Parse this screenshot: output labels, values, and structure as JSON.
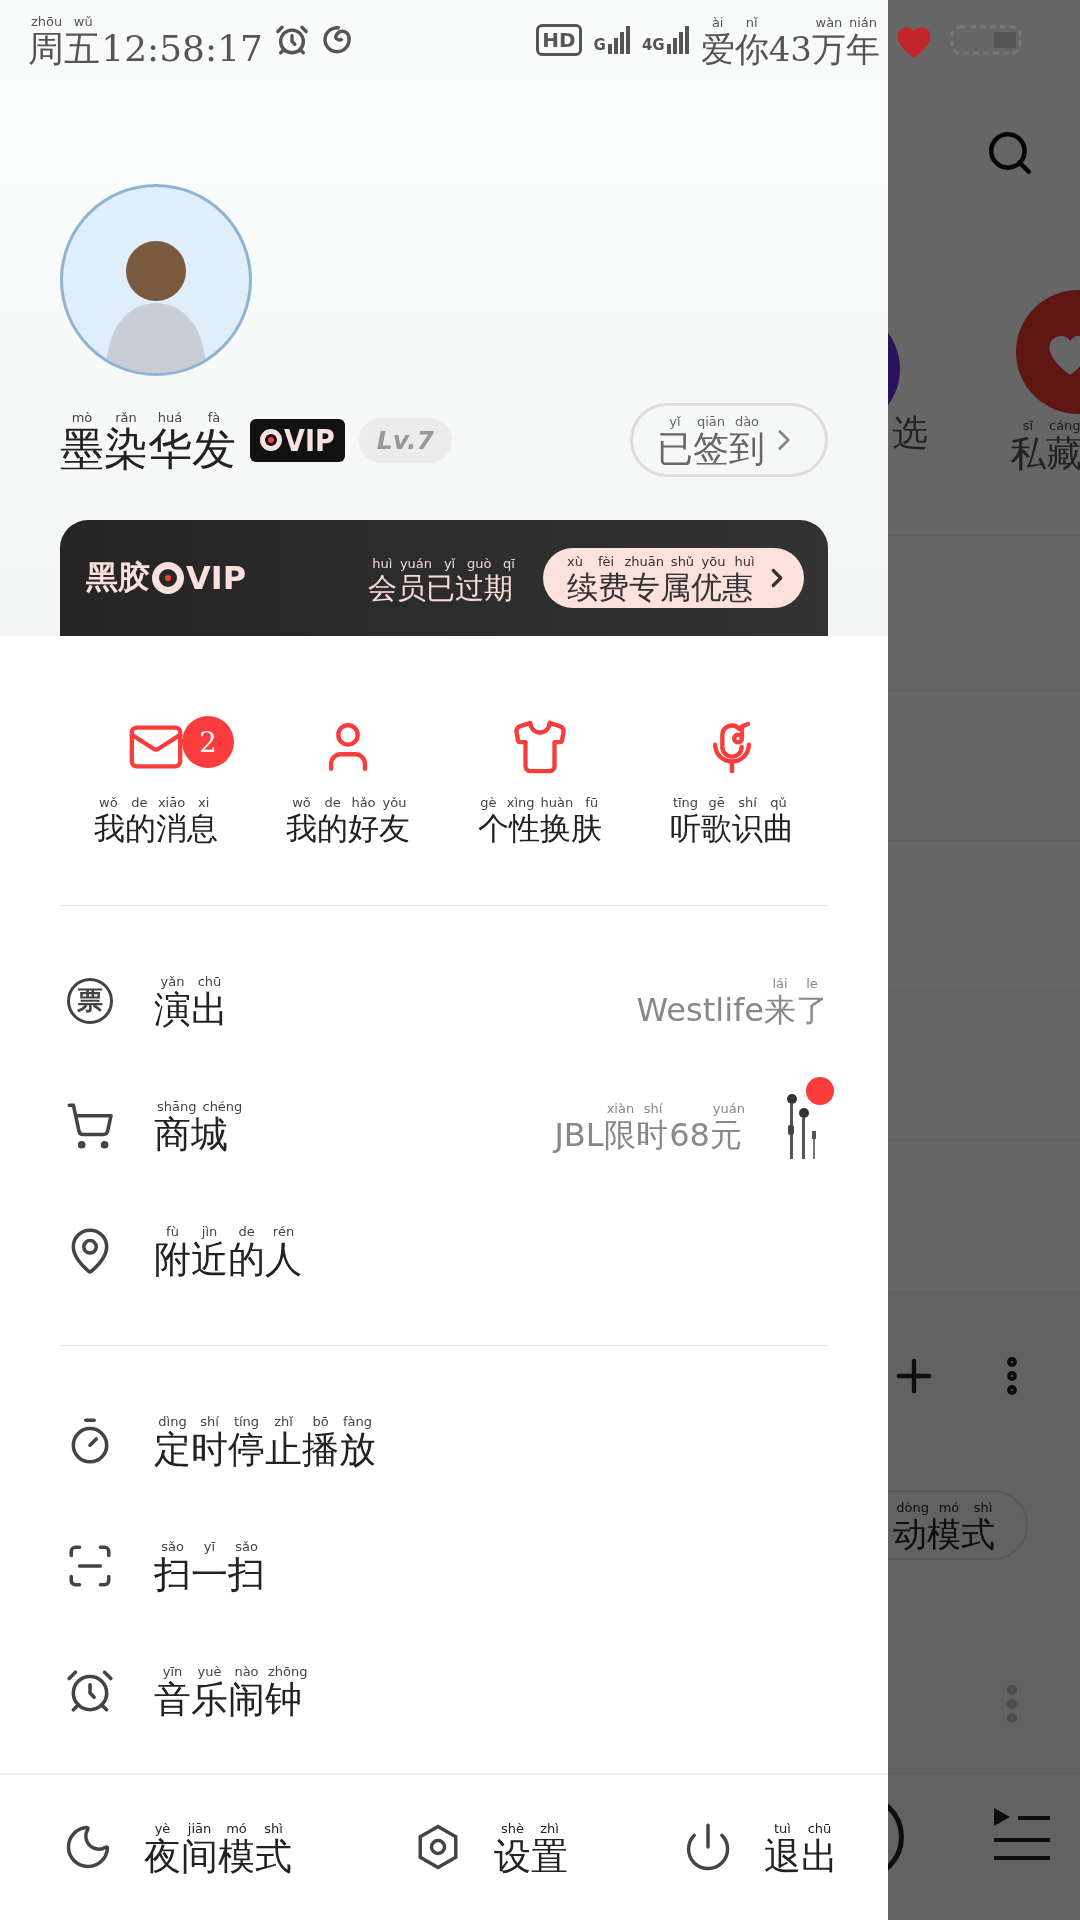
{
  "status_bar": {
    "time": [
      {
        "text": "周五",
        "pinyin": "zhōu wǔ"
      },
      {
        "text": "12:58:17"
      }
    ],
    "network": "HD",
    "signals": [
      "G",
      "4G"
    ],
    "carrier": [
      {
        "text": "爱你",
        "pinyin": "ài nǐ"
      },
      {
        "text": "43"
      },
      {
        "text": "万年",
        "pinyin": "wàn nián"
      }
    ]
  },
  "profile": {
    "name": [
      {
        "text": "墨染华发",
        "pinyin": "mò rǎn huá fà"
      }
    ],
    "vip_logo": "VIP",
    "rank": "Lv.7",
    "checkin": [
      {
        "text": "已签到",
        "pinyin": "yǐ qiān dào"
      }
    ]
  },
  "vip_card": {
    "brand": "黑胶",
    "logo": "VIP",
    "status": [
      {
        "text": "会员已过期",
        "pinyin": "huì yuán yǐ guò qī"
      }
    ],
    "renew": [
      {
        "text": "续费专属优惠",
        "pinyin": "xù fèi zhuān shǔ yōu huì"
      }
    ]
  },
  "shortcuts": [
    {
      "kind": "mail",
      "label": [
        {
          "text": "我的消息",
          "pinyin": "wǒ de xiāo xi"
        }
      ],
      "badge": "2"
    },
    {
      "kind": "friend",
      "label": [
        {
          "text": "我的好友",
          "pinyin": "wǒ de hǎo yǒu"
        }
      ]
    },
    {
      "kind": "skin",
      "label": [
        {
          "text": "个性换肤",
          "pinyin": "gè xìng huàn fū"
        }
      ]
    },
    {
      "kind": "recognize",
      "label": [
        {
          "text": "听歌识曲",
          "pinyin": "tīng gē shí qǔ"
        }
      ]
    }
  ],
  "menu_groups": [
    [
      {
        "kind": "ticket",
        "glyph": "票",
        "label": [
          {
            "text": "演出",
            "pinyin": "yǎn chū"
          }
        ],
        "extra": [
          {
            "text": "Westlife"
          },
          {
            "text": "来了",
            "pinyin": "lái le"
          }
        ],
        "dot": false
      },
      {
        "kind": "cart",
        "label": [
          {
            "text": "商城",
            "pinyin": "shāng chéng"
          }
        ],
        "extra": [
          {
            "text": "JBL"
          },
          {
            "text": "限时",
            "pinyin": "xiàn shí"
          },
          {
            "text": "68"
          },
          {
            "text": "元",
            "pinyin": "yuán"
          }
        ],
        "thumbnail": {
          "kind": "picture"
        },
        "dot": true
      },
      {
        "kind": "pin",
        "label": [
          {
            "text": "附近的人",
            "pinyin": "fù jìn de rén"
          }
        ],
        "dot": false
      }
    ],
    [
      {
        "kind": "timer",
        "label": [
          {
            "text": "定时停止播放",
            "pinyin": "dìng shí tíng zhǐ bō fàng"
          }
        ],
        "dot": false
      },
      {
        "kind": "scan",
        "label": [
          {
            "text": "扫一扫",
            "pinyin": "sǎo yī sǎo"
          }
        ],
        "dot": false
      },
      {
        "kind": "alarm",
        "label": [
          {
            "text": "音乐闹钟",
            "pinyin": "yīn yuè nào zhōng"
          }
        ],
        "dot": false
      }
    ]
  ],
  "bottom_bar": [
    {
      "kind": "moon",
      "label": [
        {
          "text": "夜间模式",
          "pinyin": "yè jiān mó shì"
        }
      ]
    },
    {
      "kind": "settings",
      "label": [
        {
          "text": "设置",
          "pinyin": "shè zhì"
        }
      ]
    },
    {
      "kind": "power",
      "label": [
        {
          "text": "退出",
          "pinyin": "tuì chū"
        }
      ]
    }
  ],
  "background": {
    "labels": [
      [
        {
          "text": "选"
        }
      ],
      [
        {
          "text": "私藏",
          "pinyin": "sī cáng"
        }
      ]
    ],
    "mode": [
      {
        "text": "动模式",
        "pinyin": "dòng mó shì"
      }
    ]
  }
}
